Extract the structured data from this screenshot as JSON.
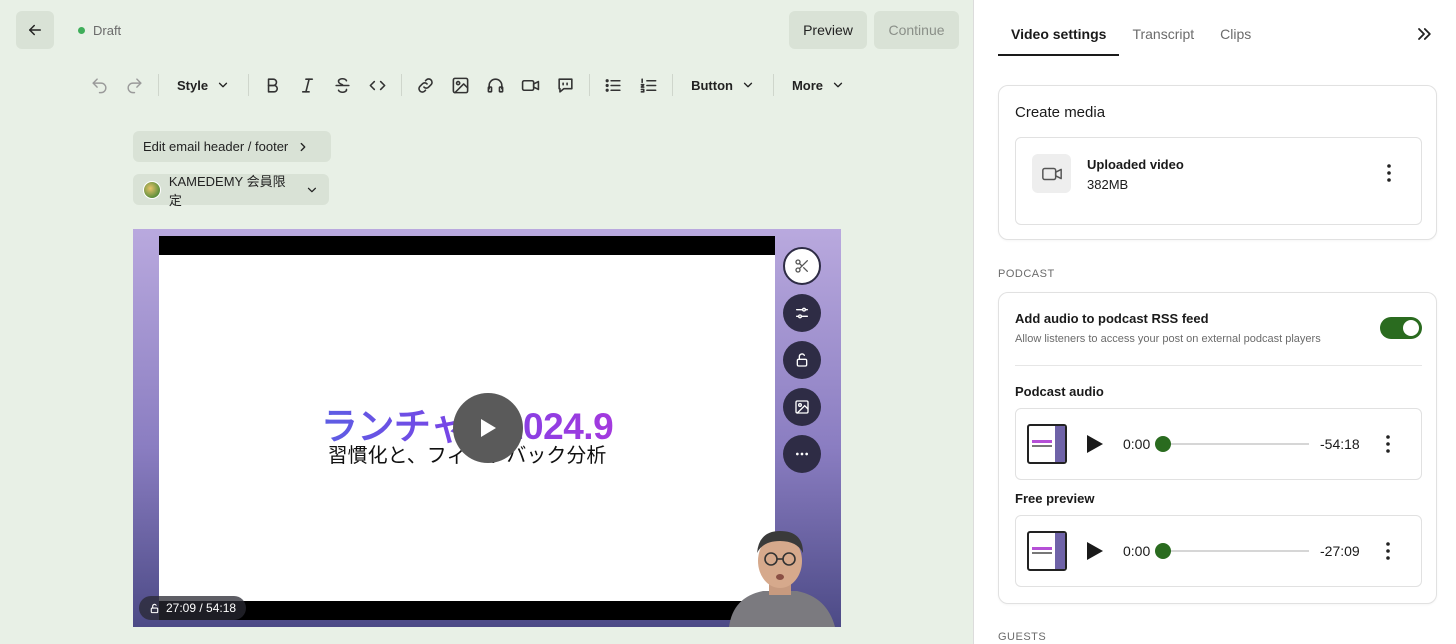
{
  "header": {
    "status": "Draft",
    "preview_label": "Preview",
    "continue_label": "Continue",
    "colors": {
      "status_dot": "#3fae5a",
      "editor_bg": "#e8f0e6",
      "accent_green": "#2a6b1f"
    }
  },
  "toolbar": {
    "style_label": "Style",
    "button_label": "Button",
    "more_label": "More",
    "icons": [
      "undo-icon",
      "redo-icon",
      "bold-icon",
      "italic-icon",
      "strikethrough-icon",
      "code-icon",
      "link-icon",
      "image-icon",
      "audio-icon",
      "video-icon",
      "quote-icon",
      "bullet-list-icon",
      "numbered-list-icon"
    ]
  },
  "editor": {
    "header_footer_label": "Edit email header / footer",
    "audience_label": "KAMEDEMY 会員限定"
  },
  "video": {
    "slide_title": "ランチャレ2024.9",
    "slide_subtitle": "習慣化と、フィードバック分析",
    "time_label": "27:09 / 54:18",
    "rail_icons": [
      "scissors-icon",
      "sliders-icon",
      "unlock-icon",
      "image-icon",
      "more-icon"
    ]
  },
  "sidebar": {
    "tabs": [
      {
        "label": "Video settings",
        "active": true
      },
      {
        "label": "Transcript",
        "active": false
      },
      {
        "label": "Clips",
        "active": false
      }
    ],
    "create_media": {
      "title": "Create media",
      "item_name": "Uploaded video",
      "item_size": "382MB"
    },
    "podcast": {
      "section_label": "PODCAST",
      "rss_title": "Add audio to podcast RSS feed",
      "rss_desc": "Allow listeners to access your post on external podcast players",
      "rss_enabled": true,
      "audio_label": "Podcast audio",
      "audio_start": "0:00",
      "audio_end": "-54:18",
      "preview_label": "Free preview",
      "preview_start": "0:00",
      "preview_end": "-27:09"
    },
    "guests_label": "GUESTS"
  }
}
